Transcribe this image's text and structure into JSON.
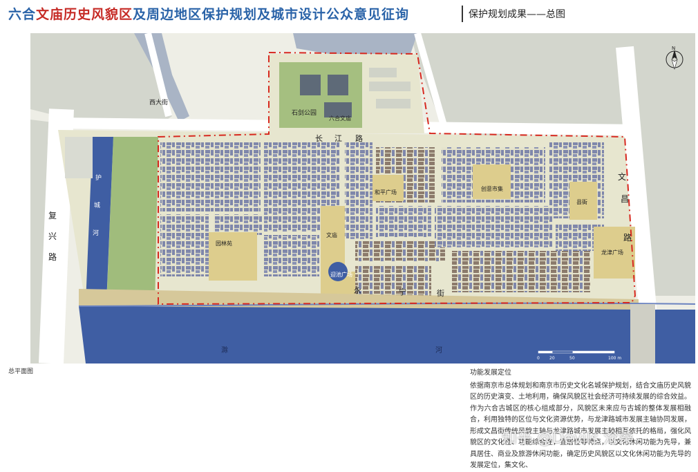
{
  "header": {
    "title_prefix": "六合",
    "title_highlight": "文庙历史风貌区",
    "title_suffix": "及周边地区保护规划及城市设计公众意见征询",
    "subtitle": "保护规划成果——总图"
  },
  "map": {
    "labels": {
      "xidajie": "西大街",
      "shijian_park": "石剑公园",
      "wenmiao": "六合文庙",
      "changjiang_rd": [
        "长",
        "江",
        "路"
      ],
      "fuxing_rd": [
        "复",
        "兴",
        "路"
      ],
      "wenchang_rd": [
        "文",
        "昌",
        "路"
      ],
      "yongning_st": [
        "永",
        "宁",
        "街"
      ],
      "river_moat": [
        "护",
        "城",
        "河"
      ],
      "chu_river": [
        "滁",
        "河"
      ],
      "heping_square": "和平广场",
      "chuangyi_market": "创意市集",
      "xianya": "县衙",
      "wenshu": "文庙",
      "yingchi_square": "迎池广场",
      "longjin_square": "龙津广场",
      "yuanlin": "园林苑"
    },
    "north_label": "N",
    "scale_labels": [
      "0",
      "20",
      "50",
      "100 m"
    ],
    "colors": {
      "water": "#3f5ea3",
      "building": "#7f87ab",
      "old_building": "#8c7b6c",
      "ground": "#e7e6cf",
      "plaza": "#ddcd8d",
      "green": "#8fb266",
      "road": "#ffffff",
      "lot": "#d6d8cf",
      "boundary": "#d7281f"
    }
  },
  "caption_left": "总平面图",
  "text_block": {
    "heading": "功能发展定位",
    "body": "依据南京市总体规划和南京市历史文化名城保护规划，结合文庙历史风貌区的历史演变、土地利用，确保风貌区社会经济可持续发展的综合效益。作为六合古城区的核心组成部分，风貌区未来应与古城的整体发展相融合，利用独特的区位与文化资源优势，与龙津路城市发展主轴协同发展，形成文昌街传统风貌主轴与龙津路城市发展主轴相互依托的格局，强化风貌区的文化性、功能综合性，宜居性等特点，以文化休闲功能为先导，兼具居住、商业及旅游休闲功能，确定历史风貌区以文化休闲功能为先导的发展定位，集文化、"
  },
  "watermark": "知乎 @Devils 沧桑"
}
